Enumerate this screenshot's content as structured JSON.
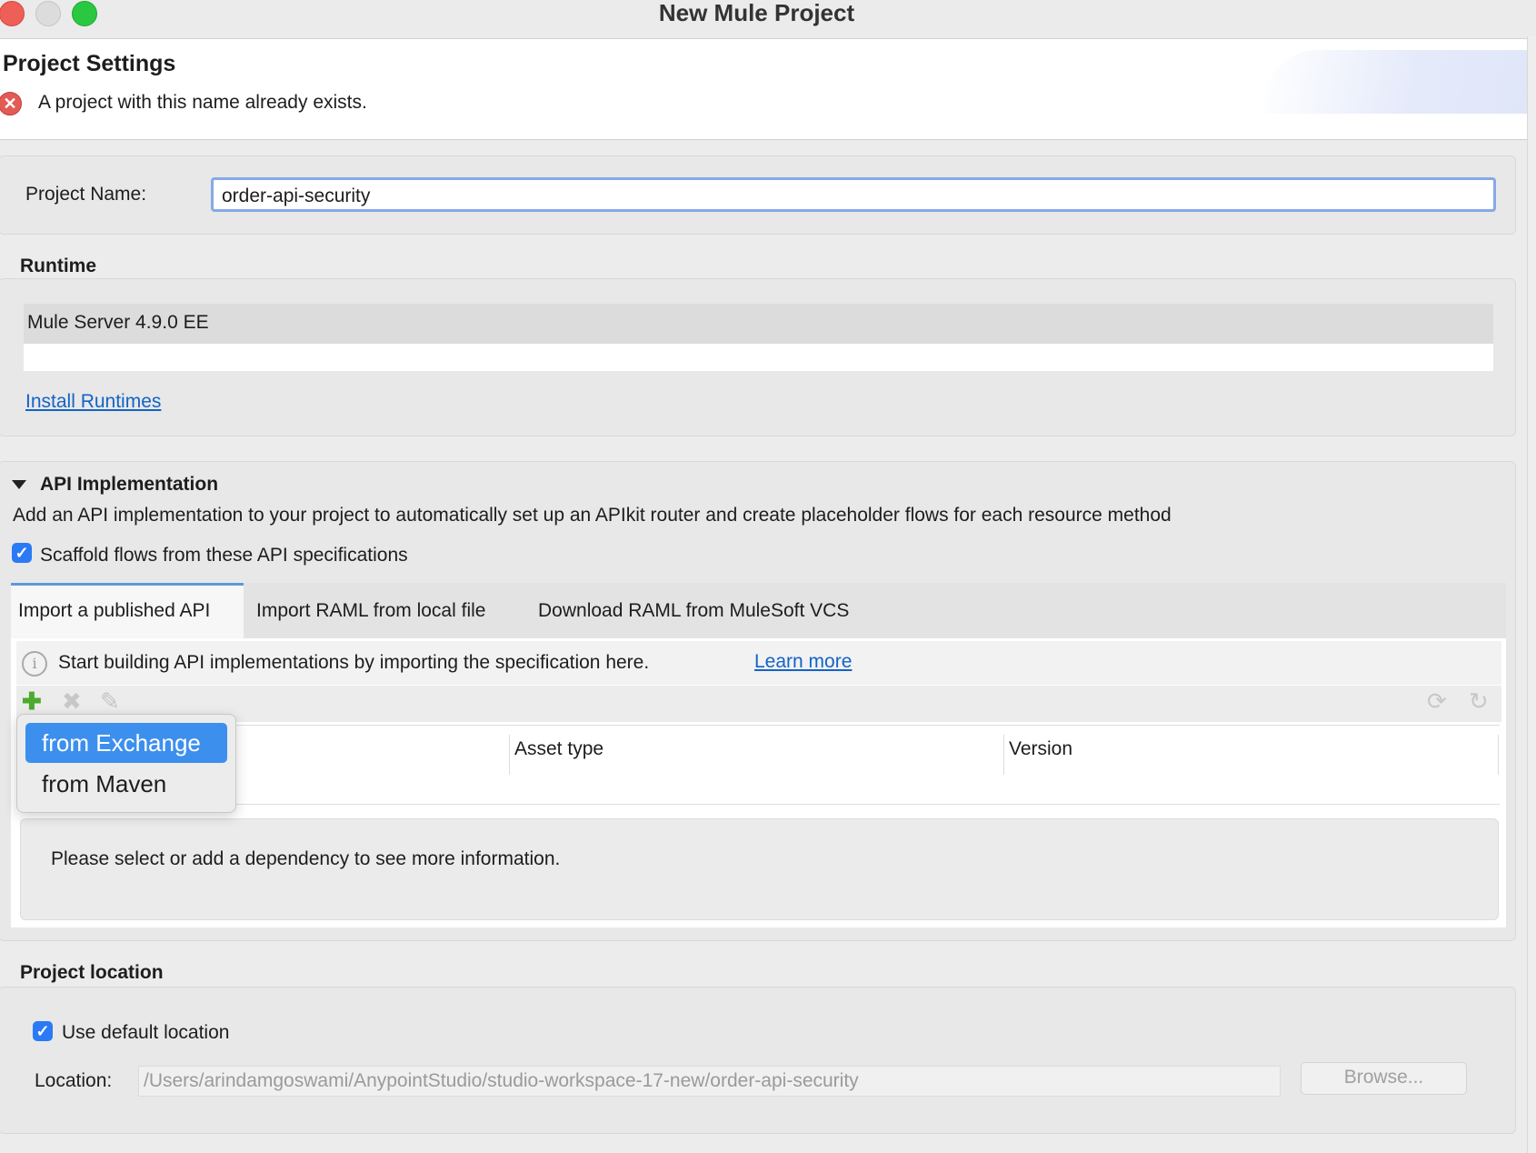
{
  "window": {
    "title": "New Mule Project"
  },
  "header": {
    "title": "Project Settings",
    "error_message": "A project with this name already exists.",
    "error_icon": "error-x-icon"
  },
  "project_name": {
    "label": "Project Name:",
    "value": "order-api-security"
  },
  "runtime": {
    "title": "Runtime",
    "selected": "Mule Server 4.9.0 EE",
    "install_link": "Install Runtimes"
  },
  "api_impl": {
    "title": "API Implementation",
    "description": "Add an API implementation to your project to automatically set up an APIkit router and create placeholder flows for each resource method",
    "scaffold_label": "Scaffold flows from these API specifications",
    "scaffold_checked": true,
    "tabs": [
      {
        "label": "Import a published API",
        "active": true
      },
      {
        "label": "Import RAML from local file",
        "active": false
      },
      {
        "label": "Download RAML from MuleSoft VCS",
        "active": false
      }
    ],
    "info_text": "Start building API implementations by importing the specification here.",
    "learn_more": "Learn more",
    "table": {
      "columns": [
        "",
        "Asset type",
        "Version"
      ]
    },
    "details_text": "Please select or add a dependency to see more information.",
    "add_menu": {
      "items": [
        {
          "label": "from Exchange",
          "selected": true
        },
        {
          "label": "from Maven",
          "selected": false
        }
      ]
    }
  },
  "location": {
    "title": "Project location",
    "use_default_label": "Use default location",
    "use_default_checked": true,
    "location_label": "Location:",
    "location_value": "/Users/arindamgoswami/AnypointStudio/studio-workspace-17-new/order-api-security",
    "browse_label": "Browse..."
  },
  "colors": {
    "accent": "#3d8fee",
    "link": "#1463c6",
    "error": "#e35b55",
    "focus_border": "#86a8e8"
  }
}
